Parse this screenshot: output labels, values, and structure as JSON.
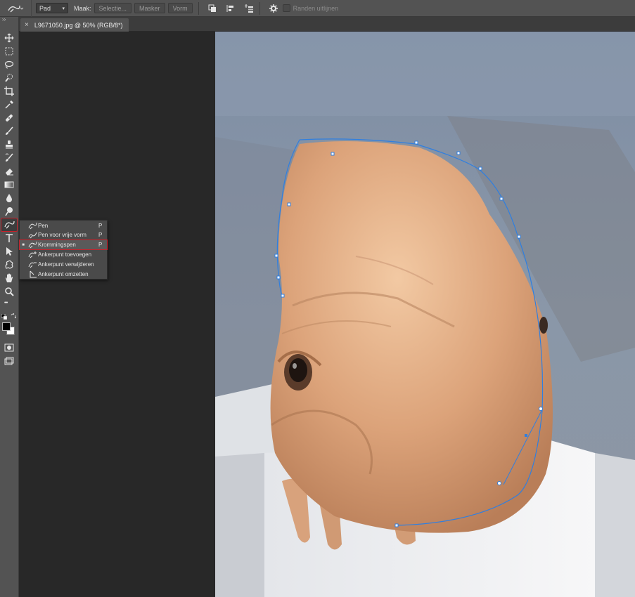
{
  "options_bar": {
    "mode_dropdown": "Pad",
    "make_label": "Maak:",
    "selection_button": "Selectie...",
    "mask_button": "Masker",
    "shape_button": "Vorm",
    "align_edges_label": "Randen uitlijnen"
  },
  "document_tab": {
    "close": "×",
    "title": "L9671050.jpg @ 50% (RGB/8*)"
  },
  "toolbar": {
    "collapse": "››",
    "more": "•••",
    "tools": [
      "move-icon",
      "marquee-icon",
      "lasso-icon",
      "quick-selection-icon",
      "crop-icon",
      "eyedropper-icon",
      "healing-brush-icon",
      "brush-icon",
      "clone-stamp-icon",
      "history-brush-icon",
      "eraser-icon",
      "gradient-icon",
      "blur-icon",
      "dodge-icon",
      "pen-icon",
      "type-icon",
      "path-selection-icon",
      "custom-shape-icon",
      "hand-icon",
      "zoom-icon"
    ]
  },
  "pen_flyout": {
    "items": [
      {
        "label": "Pen",
        "shortcut": "P",
        "selected": false
      },
      {
        "label": "Pen voor vrije vorm",
        "shortcut": "P",
        "selected": false
      },
      {
        "label": "Krommingspen",
        "shortcut": "P",
        "selected": true
      },
      {
        "label": "Ankerpunt toevoegen",
        "shortcut": "",
        "selected": false
      },
      {
        "label": "Ankerpunt verwijderen",
        "shortcut": "",
        "selected": false
      },
      {
        "label": "Ankerpunt omzetten",
        "shortcut": "",
        "selected": false
      }
    ],
    "selected_marker": "■"
  },
  "colors": {
    "accent_highlight": "#c8202a",
    "path_color": "#2f7fe0",
    "foreground": "#000000",
    "background": "#ffffff"
  }
}
